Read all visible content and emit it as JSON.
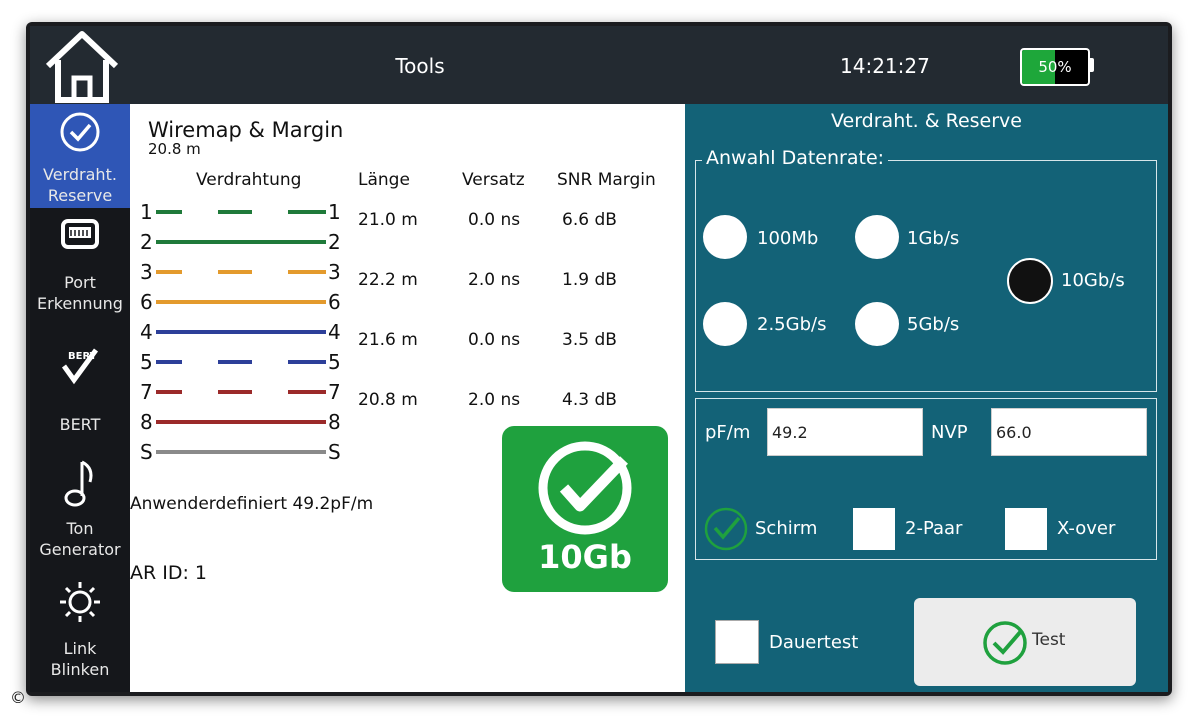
{
  "header": {
    "title": "Tools",
    "time": "14:21:27",
    "battery_label": "50%",
    "battery_level": 0.5
  },
  "sidebar": {
    "items": [
      {
        "label_line1": "Verdraht.",
        "label_line2": "Reserve",
        "icon": "check-circle-icon"
      },
      {
        "label_line1": "Port",
        "label_line2": "Erkennung",
        "icon": "ethernet-port-icon"
      },
      {
        "label_line1": "BERT",
        "label_line2": "",
        "icon": "bert-icon"
      },
      {
        "label_line1": "Ton",
        "label_line2": "Generator",
        "icon": "music-note-icon"
      },
      {
        "label_line1": "Link",
        "label_line2": "Blinken",
        "icon": "sun-icon"
      }
    ]
  },
  "main": {
    "title": "Wiremap & Margin",
    "subtitle": "20.8 m",
    "columns": [
      "Verdrahtung",
      "Länge",
      "Versatz",
      "SNR Margin"
    ],
    "wires": [
      {
        "left": "1",
        "right": "1",
        "color": "#1f7a3a",
        "striped": true
      },
      {
        "left": "2",
        "right": "2",
        "color": "#1f7a3a",
        "striped": false
      },
      {
        "left": "3",
        "right": "3",
        "color": "#e39a2d",
        "striped": true
      },
      {
        "left": "6",
        "right": "6",
        "color": "#e39a2d",
        "striped": false
      },
      {
        "left": "4",
        "right": "4",
        "color": "#2d3f99",
        "striped": false
      },
      {
        "left": "5",
        "right": "5",
        "color": "#2d3f99",
        "striped": true
      },
      {
        "left": "7",
        "right": "7",
        "color": "#9b2a2a",
        "striped": true
      },
      {
        "left": "8",
        "right": "8",
        "color": "#9b2a2a",
        "striped": false
      },
      {
        "left": "S",
        "right": "S",
        "color": "#8a8a8a",
        "striped": false
      }
    ],
    "pairs": [
      {
        "length": "21.0 m",
        "skew": "0.0 ns",
        "snr": "6.6 dB"
      },
      {
        "length": "22.2 m",
        "skew": "2.0 ns",
        "snr": "1.9 dB"
      },
      {
        "length": "21.6 m",
        "skew": "0.0 ns",
        "snr": "3.5 dB"
      },
      {
        "length": "20.8 m",
        "skew": "2.0 ns",
        "snr": "4.3 dB"
      }
    ],
    "user_defined": "Anwenderdefiniert  49.2pF/m",
    "ar_id": "AR ID: 1",
    "badge": "10Gb"
  },
  "panel": {
    "title": "Verdraht. & Reserve",
    "rate_legend": "Anwahl Datenrate:",
    "rates": [
      "100Mb",
      "1Gb/s",
      "10Gb/s",
      "2.5Gb/s",
      "5Gb/s"
    ],
    "selected_rate": "10Gb/s",
    "pf_label": "pF/m",
    "pf_value": "49.2",
    "nvp_label": "NVP",
    "nvp_value": "66.0",
    "shield_label": "Schirm",
    "shield_checked": true,
    "twopair_label": "2-Paar",
    "xover_label": "X-over",
    "continuous_label": "Dauertest",
    "test_label": "Test"
  },
  "colors": {
    "accent": "#2f56b6",
    "panel": "#136277",
    "pass": "#1fa13e"
  }
}
